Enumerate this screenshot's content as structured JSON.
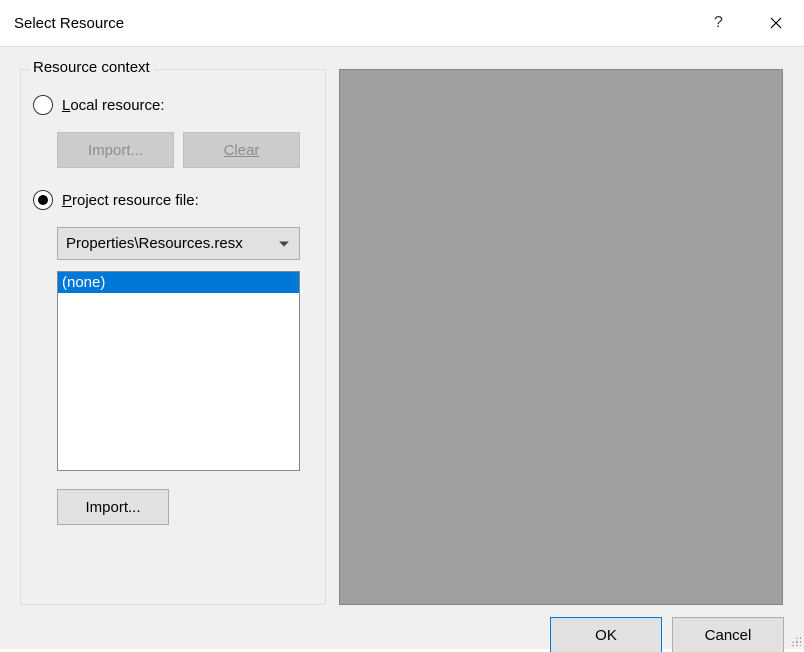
{
  "title": "Select Resource",
  "group_label": "Resource context",
  "radio_local": {
    "accel": "L",
    "rest": "ocal resource:"
  },
  "radio_project": {
    "accel": "P",
    "rest": "roject resource file:"
  },
  "buttons": {
    "import_disabled": "Import...",
    "clear_disabled": "Clear",
    "import": "Import...",
    "ok": "OK",
    "cancel": "Cancel"
  },
  "combo_value": "Properties\\Resources.resx",
  "list_items": [
    "(none)"
  ]
}
